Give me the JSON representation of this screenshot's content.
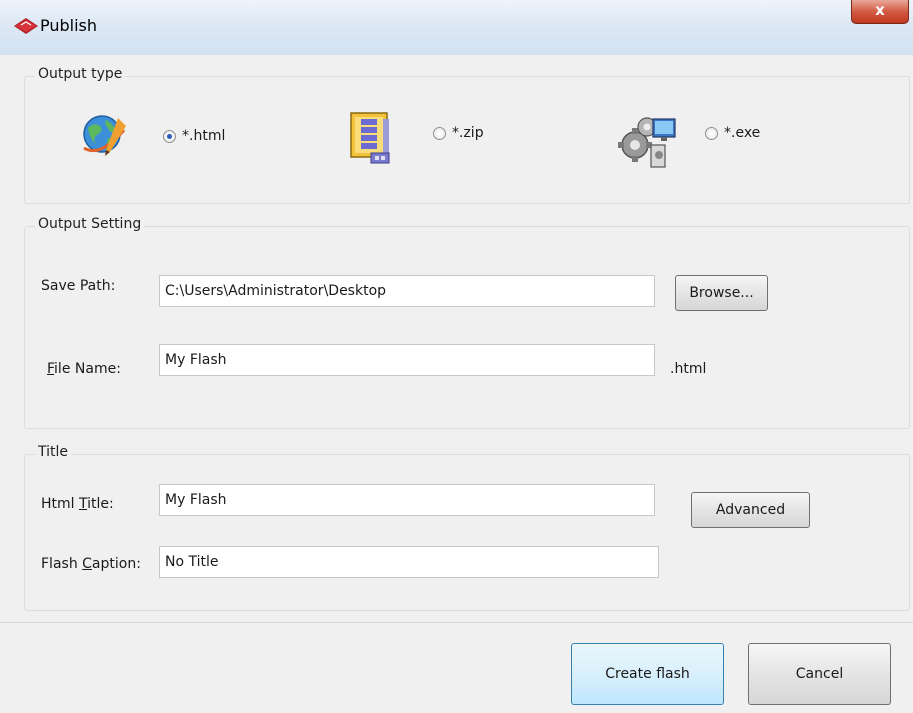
{
  "window": {
    "title": "Publish",
    "close_glyph": "x"
  },
  "output_type": {
    "legend": "Output type",
    "options": [
      {
        "label": "*.html",
        "checked": true,
        "icon": "globe-icon"
      },
      {
        "label": "*.zip",
        "checked": false,
        "icon": "zip-archive-icon"
      },
      {
        "label": "*.exe",
        "checked": false,
        "icon": "gears-computer-icon"
      }
    ]
  },
  "output_setting": {
    "legend": "Output Setting",
    "save_path_label": "Save Path:",
    "save_path_value": "C:\\Users\\Administrator\\Desktop",
    "browse_label": "Browse...",
    "file_name_label_access": "F",
    "file_name_label_rest": "ile Name:",
    "file_name_value": "My Flash",
    "file_extension": ".html"
  },
  "title_section": {
    "legend": "Title",
    "html_title_label_pre": "Html ",
    "html_title_label_access": "T",
    "html_title_label_rest": "itle:",
    "html_title_value": "My Flash",
    "advanced_label": "Advanced",
    "flash_caption_label_pre": "Flash ",
    "flash_caption_label_access": "C",
    "flash_caption_label_rest": "aption:",
    "flash_caption_value": "No Title"
  },
  "footer": {
    "create_label": "Create flash",
    "cancel_label": "Cancel"
  },
  "colors": {
    "titlebar": "#d9e6f4",
    "close_button": "#c8452d",
    "dialog_bg": "#f0f0f0",
    "primary_button": "#bee6fd"
  }
}
